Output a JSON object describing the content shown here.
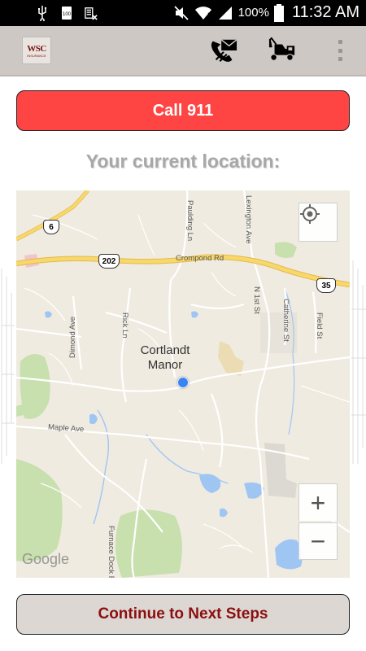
{
  "status_bar": {
    "battery_percent": "100%",
    "time": "11:32 AM"
  },
  "action_bar": {
    "logo": {
      "line1": "WSC",
      "line2": "INSURANCE"
    },
    "icons": [
      "phone-envelope-icon",
      "tow-truck-icon",
      "overflow-menu-icon"
    ]
  },
  "call_button": {
    "label": "Call 911"
  },
  "location_label": "Your current location:",
  "map": {
    "town_line1": "Cortlandt",
    "town_line2": "Manor",
    "roads": {
      "crompond": "Crompond Rd",
      "paulding": "Paulding Ln",
      "lexington": "Lexington Ave",
      "rick": "Rick Ln",
      "dimond": "Dimond Ave",
      "n1st": "N 1st St",
      "catherine": "Catherine St",
      "field": "Field St",
      "maple": "Maple Ave",
      "furnace": "Furnace Dock Rd"
    },
    "shields": {
      "route6": "6",
      "route202": "202",
      "route35": "35"
    },
    "attribution": "Google",
    "controls": {
      "zoom_in": "+",
      "zoom_out": "−"
    }
  },
  "continue_button": {
    "label": "Continue to Next Steps"
  },
  "colors": {
    "call_red": "#ff4444",
    "continue_text": "#8b0f0f",
    "action_bar": "#cdc8c4",
    "map_bg": "#efebe1",
    "highway": "#f7d86a",
    "location_dot": "#3b84f0"
  }
}
